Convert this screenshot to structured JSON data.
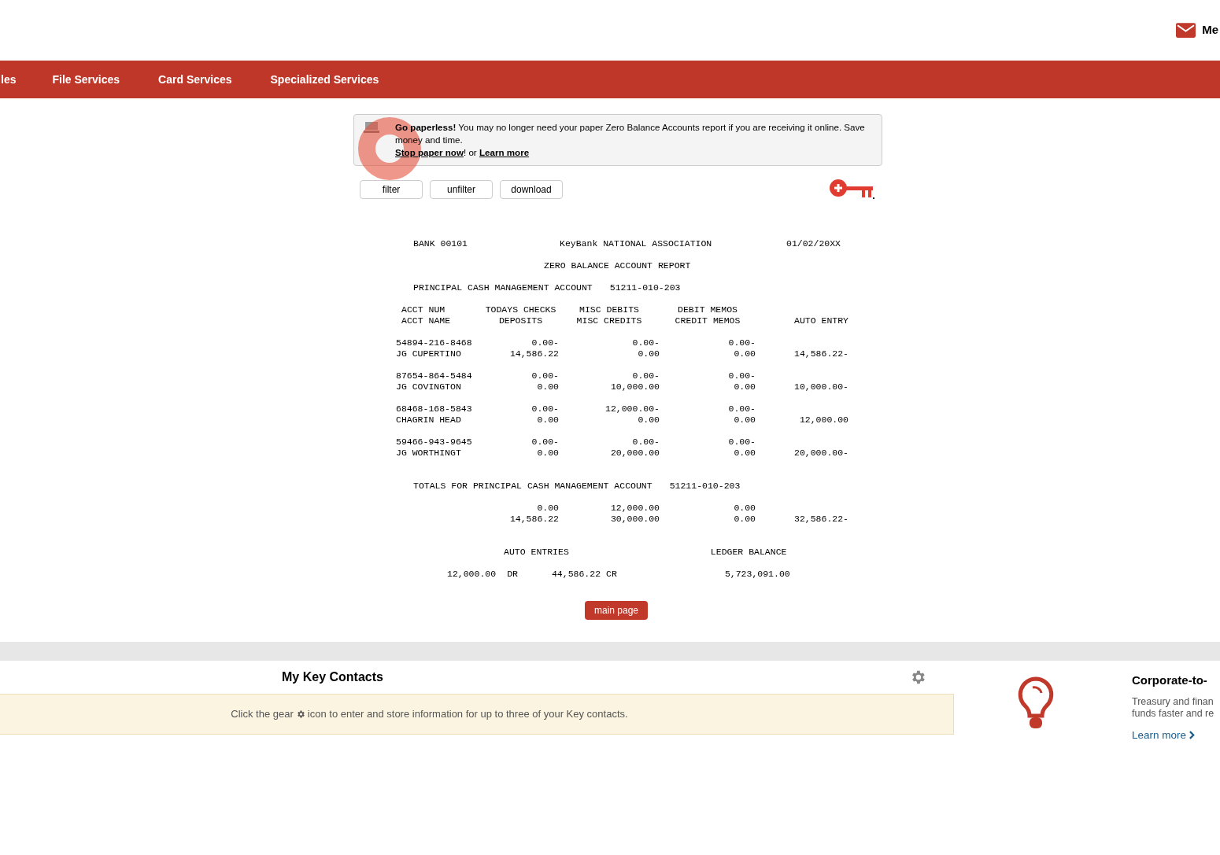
{
  "header": {
    "mail_label": "Me"
  },
  "nav": [
    {
      "label": "les"
    },
    {
      "label": "File Services"
    },
    {
      "label": "Card Services"
    },
    {
      "label": "Specialized Services"
    }
  ],
  "notice": {
    "lead": "Go paperless!",
    "text": "You may no longer need your paper Zero Balance Accounts report if you are receiving it online. Save money and time.",
    "stop_link": "Stop paper now",
    "between": "! or",
    "learn_link": "Learn more"
  },
  "toolbar": [
    "filter",
    "unfilter",
    "download"
  ],
  "report": {
    "bank": "BANK 00101",
    "bank_name": "KeyBank NATIONAL ASSOCIATION",
    "date": "01/02/20XX",
    "title": "ZERO BALANCE ACCOUNT REPORT",
    "account_label": "PRINCIPAL CASH MANAGEMENT ACCOUNT",
    "account_number": "51211-010-203",
    "columns": [
      [
        "ACCT NUM",
        "ACCT NAME"
      ],
      [
        "TODAYS CHECKS",
        "DEPOSITS"
      ],
      [
        "MISC DEBITS",
        "MISC CREDITS"
      ],
      [
        "DEBIT MEMOS",
        "CREDIT MEMOS"
      ],
      [
        "",
        "AUTO ENTRY"
      ]
    ],
    "accounts": [
      {
        "number": "54894-216-8468",
        "name": "JG CUPERTINO",
        "line1": [
          "0.00-",
          "0.00-",
          "0.00-"
        ],
        "line2": [
          "14,586.22",
          "0.00",
          "0.00",
          "14,586.22-"
        ]
      },
      {
        "number": "87654-864-5484",
        "name": "JG COVINGTON",
        "line1": [
          "0.00-",
          "0.00-",
          "0.00-"
        ],
        "line2": [
          "0.00",
          "10,000.00",
          "0.00",
          "10,000.00-"
        ]
      },
      {
        "number": "68468-168-5843",
        "name": "CHAGRIN HEAD",
        "line1": [
          "0.00-",
          "12,000.00-",
          "0.00-"
        ],
        "line2": [
          "0.00",
          "0.00",
          "0.00",
          "12,000.00"
        ]
      },
      {
        "number": "59466-943-9645",
        "name": "JG WORTHINGT",
        "line1": [
          "0.00-",
          "0.00-",
          "0.00-"
        ],
        "line2": [
          "0.00",
          "20,000.00",
          "0.00",
          "20,000.00-"
        ]
      }
    ],
    "totals_label": "TOTALS FOR PRINCIPAL CASH MANAGEMENT ACCOUNT",
    "totals_number": "51211-010-203",
    "totals_line1": [
      "0.00",
      "12,000.00",
      "0.00"
    ],
    "totals_line2": [
      "14,586.22",
      "30,000.00",
      "0.00",
      "32,586.22-"
    ],
    "auto_entries_label": "AUTO ENTRIES",
    "ledger_label": "LEDGER BALANCE",
    "dr_amount": "12,000.00",
    "dr": "DR",
    "cr_amount": "44,586.22",
    "cr": "CR",
    "ledger_balance": "5,723,091.00"
  },
  "main_page_button": "main page",
  "contacts": {
    "title": "My Key Contacts",
    "hint_before": "Click the gear",
    "hint_after": "icon to enter and store information for up to three of your Key contacts."
  },
  "promo": {
    "title": "Corporate-to-",
    "lines": [
      "Treasury and finan",
      "funds faster and re"
    ],
    "link": "Learn more"
  }
}
